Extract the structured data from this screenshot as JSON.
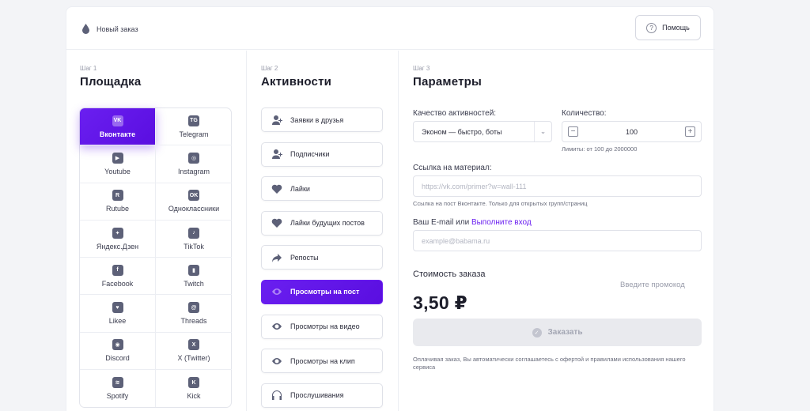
{
  "header": {
    "crumb_icon": "drop-icon",
    "crumb_label": "Новый заказ",
    "help_label": "Помощь"
  },
  "step1": {
    "step_label": "Шаг 1",
    "title": "Площадка",
    "platforms": [
      {
        "label": "Вконтакте",
        "icon": "VK",
        "active": true
      },
      {
        "label": "Telegram",
        "icon": "TG"
      },
      {
        "label": "Youtube",
        "icon": "▶"
      },
      {
        "label": "Instagram",
        "icon": "◎"
      },
      {
        "label": "Rutube",
        "icon": "R"
      },
      {
        "label": "Одноклассники",
        "icon": "OK"
      },
      {
        "label": "Яндекс.Дзен",
        "icon": "✦"
      },
      {
        "label": "TikTok",
        "icon": "♪"
      },
      {
        "label": "Facebook",
        "icon": "f"
      },
      {
        "label": "Twitch",
        "icon": "▮"
      },
      {
        "label": "Likee",
        "icon": "♥"
      },
      {
        "label": "Threads",
        "icon": "@"
      },
      {
        "label": "Discord",
        "icon": "◉"
      },
      {
        "label": "X (Twitter)",
        "icon": "X"
      },
      {
        "label": "Spotify",
        "icon": "≋"
      },
      {
        "label": "Kick",
        "icon": "K"
      }
    ]
  },
  "step2": {
    "step_label": "Шаг 2",
    "title": "Активности",
    "activities": [
      {
        "label": "Заявки в друзья",
        "icon": "user-plus-icon"
      },
      {
        "label": "Подписчики",
        "icon": "user-plus-icon"
      },
      {
        "label": "Лайки",
        "icon": "heart-icon"
      },
      {
        "label": "Лайки будущих постов",
        "icon": "heart-icon"
      },
      {
        "label": "Репосты",
        "icon": "share-arrow-icon"
      },
      {
        "label": "Просмотры на пост",
        "icon": "eye-icon",
        "active": true
      },
      {
        "label": "Просмотры на видео",
        "icon": "eye-icon"
      },
      {
        "label": "Просмотры на клип",
        "icon": "eye-icon"
      },
      {
        "label": "Прослушивания",
        "icon": "headphones-icon"
      }
    ]
  },
  "step3": {
    "step_label": "Шаг 3",
    "title": "Параметры",
    "quality_label": "Качество активностей:",
    "quality_value": "Эконом — быстро, боты",
    "quantity_label": "Количество:",
    "quantity_value": "100",
    "quantity_hint": "Лимиты: от 100 до 2000000",
    "link_label": "Ссылка на материал:",
    "link_placeholder": "https://vk.com/primer?w=wall-111",
    "link_hint": "Ссылка на пост Вконтакте. Только для открытых групп/страниц",
    "email_label_prefix": "Ваш E-mail или",
    "email_label_link": "Выполните вход",
    "email_placeholder": "example@babama.ru",
    "cost_label": "Стоимость заказа",
    "price": "3,50 ₽",
    "promo_label": "Введите промокод",
    "order_label": "Заказать",
    "note": "Оплачивая заказ, Вы автоматически соглашаетесь с офертой и правилами использования нашего сервиса"
  }
}
